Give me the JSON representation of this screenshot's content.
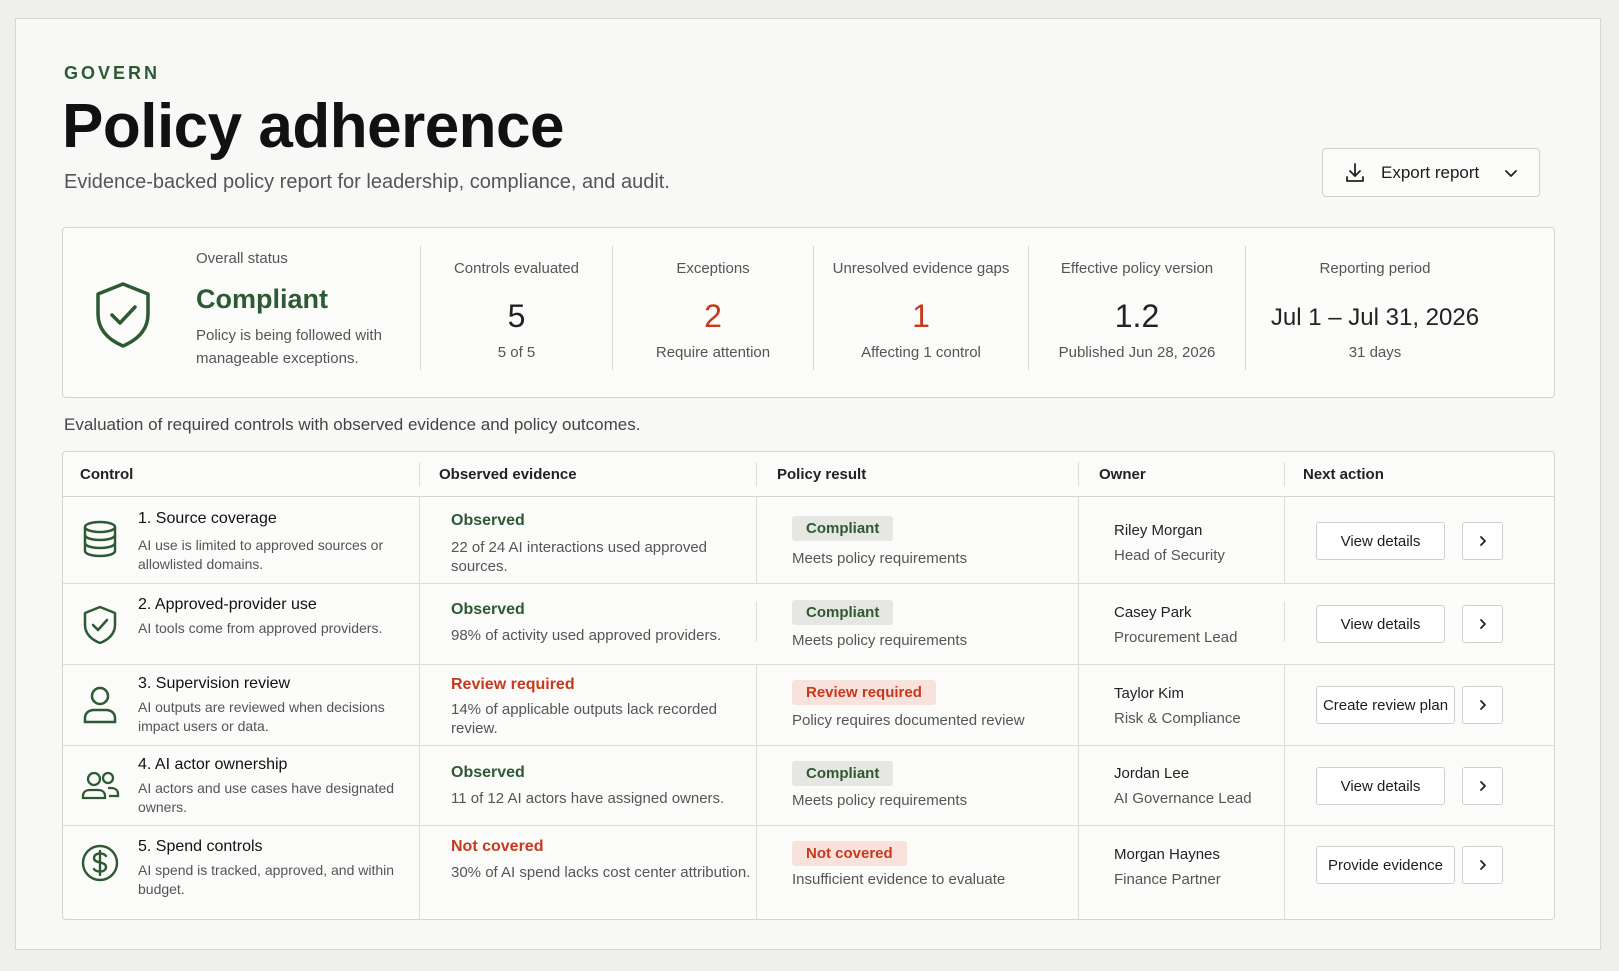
{
  "header": {
    "eyebrow": "GOVERN",
    "title": "Policy adherence",
    "subtitle": "Evidence-backed policy report for leadership, compliance, and audit.",
    "export_label": "Export report"
  },
  "summary": {
    "overall_label": "Overall status",
    "overall_value": "Compliant",
    "overall_desc": "Policy is being followed with manageable exceptions.",
    "stats": [
      {
        "label": "Controls evaluated",
        "value": "5",
        "sub": "5 of 5"
      },
      {
        "label": "Exceptions",
        "value": "2",
        "sub": "Require attention"
      },
      {
        "label": "Unresolved evidence gaps",
        "value": "1",
        "sub": "Affecting 1 control"
      },
      {
        "label": "Effective policy version",
        "value": "1.2",
        "sub": "Published Jun 28, 2026"
      },
      {
        "label": "Reporting period",
        "value": "Jul 1 – Jul 31, 2026",
        "sub": "31 days"
      }
    ]
  },
  "table": {
    "caption": "Evaluation of required controls with observed evidence and policy outcomes.",
    "headers": [
      "Control",
      "Observed evidence",
      "Policy result",
      "Owner",
      "Next action"
    ],
    "rows": [
      {
        "icon": "database-icon",
        "title": "1.  Source coverage",
        "desc": "AI use is limited to approved sources or allowlisted domains.",
        "ev_status": "Observed",
        "ev_desc": "22 of 24 AI interactions used approved sources.",
        "result": "Compliant",
        "result_desc": "Meets policy requirements",
        "owner": "Riley Morgan",
        "role": "Head of Security",
        "action": "View details"
      },
      {
        "icon": "shield-check-icon",
        "title": "2.  Approved-provider use",
        "desc": "AI tools come from approved providers.",
        "ev_status": "Observed",
        "ev_desc": "98% of activity used approved providers.",
        "result": "Compliant",
        "result_desc": "Meets policy requirements",
        "owner": "Casey Park",
        "role": "Procurement Lead",
        "action": "View details"
      },
      {
        "icon": "user-icon",
        "title": "3.  Supervision review",
        "desc": "AI outputs are reviewed when decisions impact users or data.",
        "ev_status": "Review required",
        "ev_desc": "14% of applicable outputs lack recorded review.",
        "result": "Review required",
        "result_desc": "Policy requires documented review",
        "owner": "Taylor Kim",
        "role": "Risk & Compliance",
        "action": "Create review plan"
      },
      {
        "icon": "users-icon",
        "title": "4.  AI actor ownership",
        "desc": "AI actors and use cases have designated owners.",
        "ev_status": "Observed",
        "ev_desc": "11 of 12 AI actors have assigned owners.",
        "result": "Compliant",
        "result_desc": "Meets policy requirements",
        "owner": "Jordan Lee",
        "role": "AI Governance Lead",
        "action": "View details"
      },
      {
        "icon": "dollar-icon",
        "title": "5.  Spend controls",
        "desc": "AI spend is tracked, approved, and within budget.",
        "ev_status": "Not covered",
        "ev_desc": "30% of AI spend lacks cost center attribution.",
        "result": "Not covered",
        "result_desc": "Insufficient evidence to evaluate",
        "owner": "Morgan Haynes",
        "role": "Finance Partner",
        "action": "Provide evidence"
      }
    ]
  },
  "colors": {
    "accent_green": "#2d5a33",
    "alert_red": "#c7391c"
  }
}
